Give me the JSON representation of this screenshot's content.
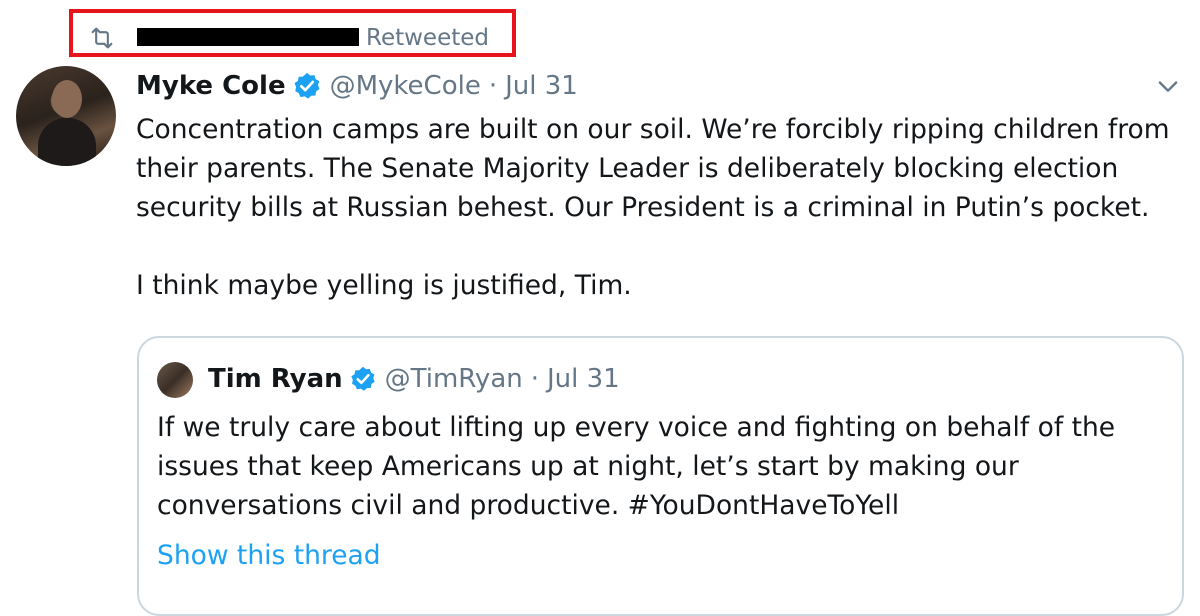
{
  "retweet_header": {
    "icon": "retweet-icon",
    "label": "Retweeted",
    "highlight_color": "#e8141c"
  },
  "tweet": {
    "author_name": "Myke Cole",
    "handle": "@MykeCole",
    "separator": "·",
    "date": "Jul 31",
    "verified": true,
    "text_lines": [
      "Concentration camps are built on our soil. We’re forcibly ripping children from",
      "their parents. The Senate Majority Leader is deliberately blocking election",
      "security bills at Russian behest. Our President is a criminal in Putin’s pocket.",
      "I think maybe yelling is justified, Tim."
    ]
  },
  "quoted_tweet": {
    "author_name": "Tim Ryan",
    "handle": "@TimRyan",
    "separator": "·",
    "date": "Jul 31",
    "verified": true,
    "text_lines": [
      "If we truly care about lifting up every voice and fighting on behalf of the",
      "issues that keep Americans up at night, let’s start by making our",
      "conversations civil and productive. #YouDontHaveToYell"
    ],
    "thread_link": "Show this thread"
  },
  "colors": {
    "text": "#14171a",
    "secondary": "#657786",
    "link": "#1da1f2",
    "verified": "#1da1f2",
    "border": "#ccd6dd"
  }
}
